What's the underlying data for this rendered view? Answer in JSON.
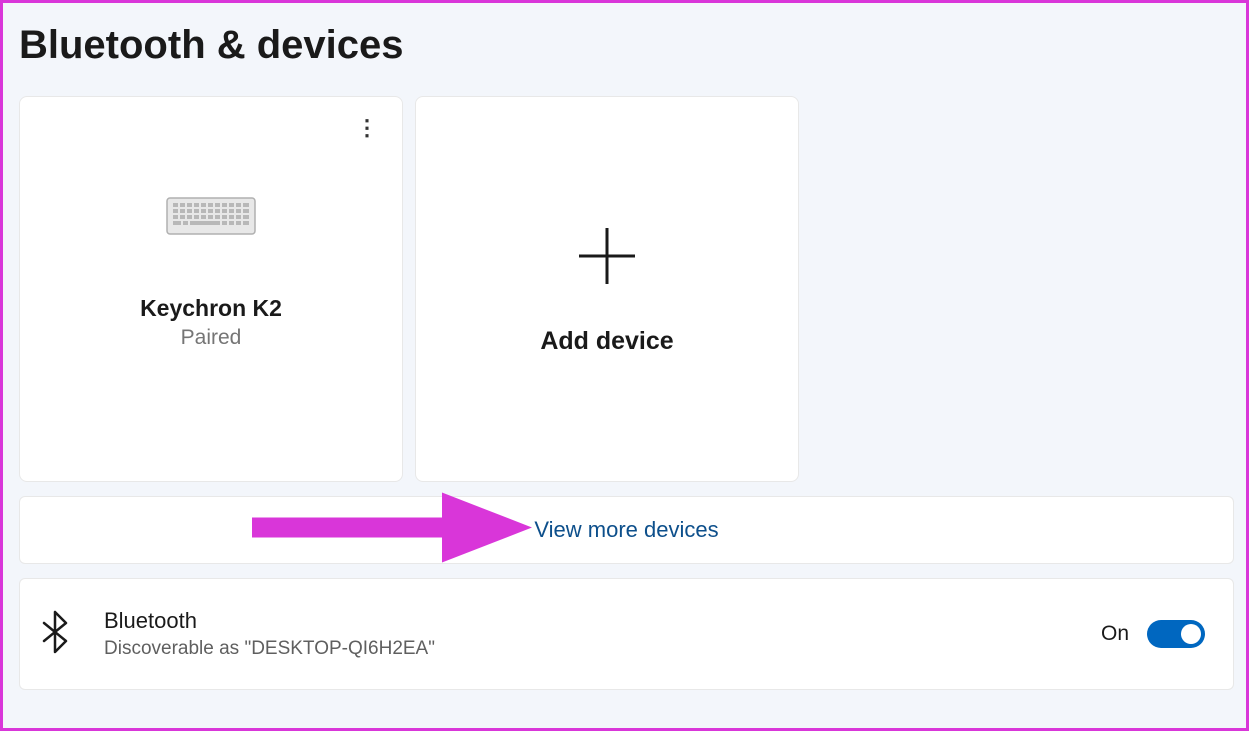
{
  "page_title": "Bluetooth & devices",
  "devices": [
    {
      "name": "Keychron K2",
      "status": "Paired"
    }
  ],
  "add_device": {
    "label": "Add device"
  },
  "view_more": {
    "label": "View more devices"
  },
  "bluetooth": {
    "title": "Bluetooth",
    "subtitle": "Discoverable as \"DESKTOP-QI6H2EA\"",
    "toggle_label": "On",
    "toggle_state": true
  }
}
